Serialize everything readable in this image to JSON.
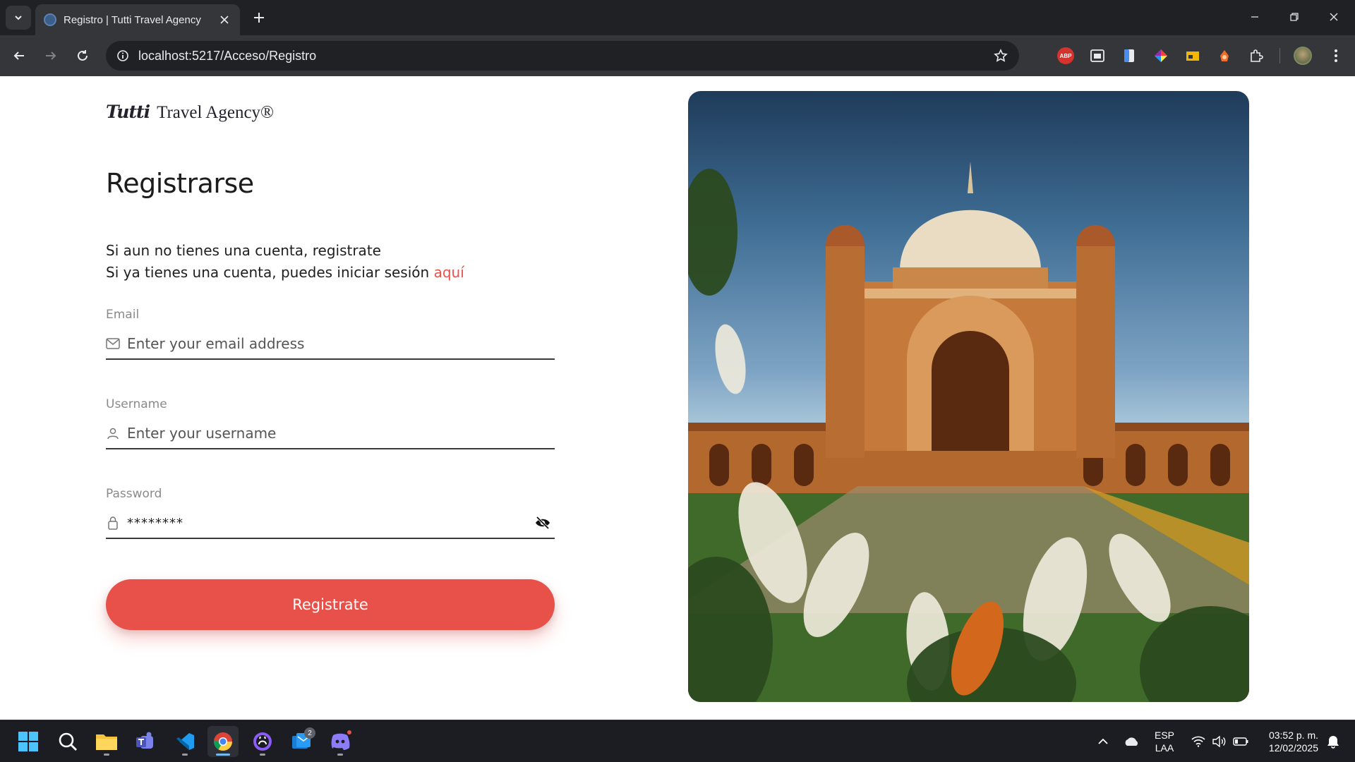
{
  "browser": {
    "tab_title": "Registro | Tutti Travel Agency",
    "url": "localhost:5217/Acceso/Registro",
    "extensions": [
      "abp-icon",
      "window-icon",
      "document-icon",
      "color-picker-icon",
      "folder-tag-icon",
      "fox-icon",
      "puzzle-icon"
    ],
    "abp_label": "ABP"
  },
  "page": {
    "logo_script": "Tutti",
    "logo_text": "Travel Agency®",
    "title": "Registrarse",
    "intro_line1": "Si aun no tienes una cuenta, registrate",
    "intro_line2": "Si ya tienes una cuenta, puedes iniciar sesión",
    "login_link": "aquí",
    "email": {
      "label": "Email",
      "placeholder": "Enter your email address",
      "icon": "mail-icon"
    },
    "username": {
      "label": "Username",
      "placeholder": "Enter your username",
      "icon": "user-icon"
    },
    "password": {
      "label": "Password",
      "value": "********",
      "icon": "lock-icon",
      "toggle_icon": "eye-slash-icon"
    },
    "submit_label": "Registrate",
    "accent_color": "#e8504a"
  },
  "taskbar": {
    "apps": [
      "windows-start-icon",
      "search-icon",
      "file-explorer-icon",
      "teams-icon",
      "vscode-icon",
      "chrome-icon",
      "github-desktop-icon",
      "mail-app-icon",
      "discord-icon"
    ],
    "mail_badge": "2",
    "lang_line1": "ESP",
    "lang_line2": "LAA",
    "time": "03:52 p. m.",
    "date": "12/02/2025"
  }
}
